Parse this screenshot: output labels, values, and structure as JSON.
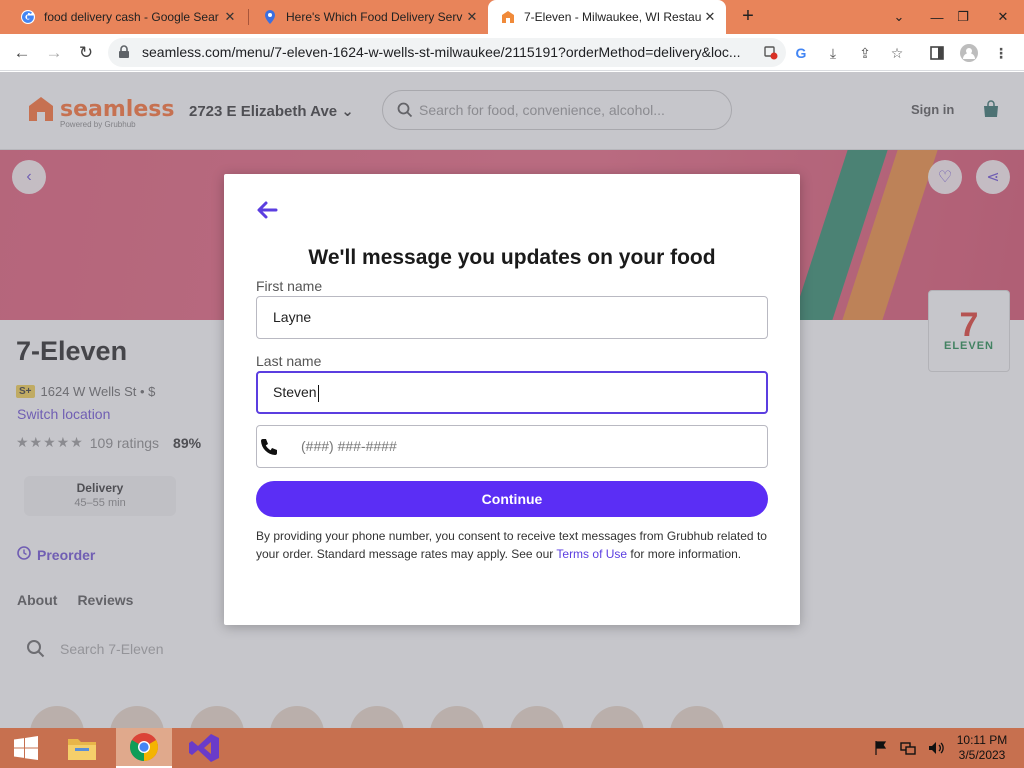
{
  "browser": {
    "tabs": [
      {
        "label": "food delivery cash - Google Sear",
        "icon": "google-icon",
        "active": false
      },
      {
        "label": "Here's Which Food Delivery Serv",
        "icon": "location-pin-icon",
        "active": false
      },
      {
        "label": "7-Eleven - Milwaukee, WI Restau",
        "icon": "seamless-icon",
        "active": true
      }
    ],
    "url": "seamless.com/menu/7-eleven-1624-w-wells-st-milwaukee/2115191?orderMethod=delivery&loc..."
  },
  "site": {
    "logo_name": "seamless",
    "logo_sub": "Powered by Grubhub",
    "address": "2723 E Elizabeth Ave",
    "search_placeholder": "Search for food, convenience, alcohol...",
    "signin": "Sign in"
  },
  "store": {
    "name": "7-Eleven",
    "badge": "S+",
    "address": "1624 W Wells St • $",
    "switch_location": "Switch location",
    "stars": "★★★★★",
    "ratings": "109 ratings",
    "pct": "89%",
    "delivery_label": "Delivery",
    "delivery_time": "45–55 min",
    "preorder": "Preorder",
    "tabs": [
      "About",
      "Reviews"
    ],
    "menu_search_placeholder": "Search 7-Eleven",
    "logo_top": "7",
    "logo_bottom": "ELEVEN"
  },
  "modal": {
    "title": "We'll message you updates on your food",
    "first_name_label": "First name",
    "first_name_value": "Layne",
    "last_name_label": "Last name",
    "last_name_value": "Steven",
    "phone_placeholder": "(###) ###-####",
    "continue_label": "Continue",
    "disclaimer_before": "By providing your phone number, you consent to receive text messages from Grubhub related to your order. Standard message rates may apply. See our ",
    "terms_link": "Terms of Use",
    "disclaimer_after": " for more information."
  },
  "taskbar": {
    "time": "10:11 PM",
    "date": "3/5/2023"
  },
  "colors": {
    "accent": "#5b2ef5",
    "tabbar": "#e8845a",
    "taskbar": "#c7704f",
    "hero": "#e25a76"
  }
}
